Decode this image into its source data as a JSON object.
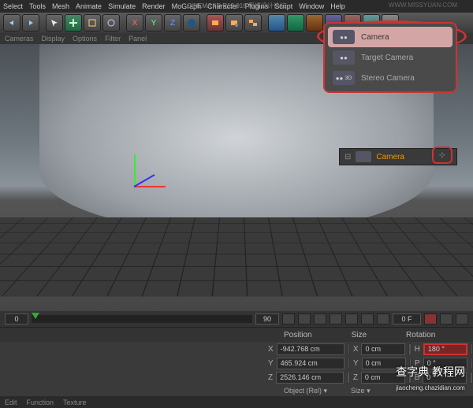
{
  "app_title": "CINEMA 4D R13.016",
  "title_extra": "思维设计论坛",
  "watermark_url": "WWW.MISSYUAN.COM",
  "menubar": [
    "Select",
    "Tools",
    "Mesh",
    "Animate",
    "Simulate",
    "Render",
    "MoGraph",
    "Character",
    "Plugins",
    "Script",
    "Window",
    "Help"
  ],
  "subbar": [
    "Cameras",
    "Display",
    "Options",
    "Filter",
    "Panel"
  ],
  "dropdown": {
    "items": [
      {
        "label": "Camera",
        "sel": true
      },
      {
        "label": "Target Camera",
        "sel": false
      },
      {
        "label": "Stereo Camera",
        "sel": false
      }
    ]
  },
  "object_panel": {
    "item": "Camera"
  },
  "coord": {
    "headers": {
      "pos": "Position",
      "size": "Size",
      "rot": "Rotation"
    },
    "rows": [
      {
        "axis": "X",
        "pos": "-942.768 cm",
        "saxis": "X",
        "size": "0 cm",
        "raxis": "H",
        "rot": "180 °"
      },
      {
        "axis": "Y",
        "pos": "465.924 cm",
        "saxis": "Y",
        "size": "0 cm",
        "raxis": "P",
        "rot": "0 °"
      },
      {
        "axis": "Z",
        "pos": "2526.146 cm",
        "saxis": "Z",
        "size": "0 cm",
        "raxis": "B",
        "rot": "0 °"
      }
    ],
    "mode": "Object (Rel)",
    "size_btn": "Size"
  },
  "timeline": {
    "start": "0",
    "current": "0 F",
    "end": "90"
  },
  "bottom_tabs": [
    "Edit",
    "Function",
    "Texture"
  ],
  "watermark_main": "查字典 教程网",
  "watermark_sub": "jiaocheng.chazidian.com"
}
